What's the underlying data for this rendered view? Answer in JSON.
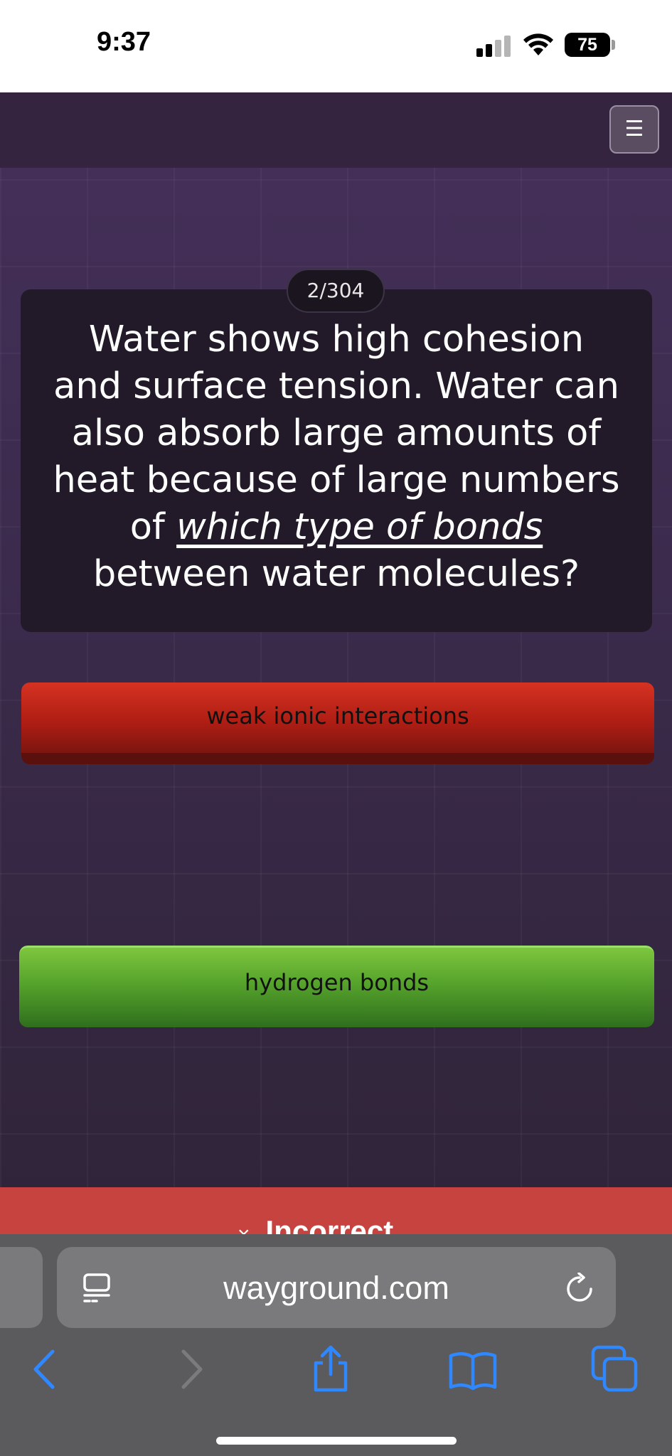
{
  "status_bar": {
    "time": "9:37",
    "battery": "75",
    "icons": [
      "signal-icon",
      "wifi-icon",
      "battery-icon"
    ]
  },
  "app": {
    "menu_icon": "hamburger-menu-icon",
    "menu_glyph": "☰",
    "question_counter": "2/304",
    "question": {
      "part1": "Water shows high cohesion and surface tension. Water can also absorb large amounts of heat because of large numbers of ",
      "emphasis": "which type of bonds",
      "part2": " between water molecules?"
    },
    "answers": [
      {
        "label": "weak ionic interactions",
        "state": "incorrect",
        "color": "#c8281c"
      },
      {
        "label": "hydrogen bonds",
        "state": "correct",
        "color": "#5aa52f"
      }
    ],
    "result": {
      "icon": "close-icon",
      "glyph": "×",
      "label": "Incorrect",
      "color": "#c6433f"
    }
  },
  "browser": {
    "url": "wayground.com",
    "icons": [
      "reader-icon",
      "reload-icon",
      "back-icon",
      "forward-icon",
      "share-icon",
      "bookmarks-icon",
      "tabs-icon"
    ]
  }
}
